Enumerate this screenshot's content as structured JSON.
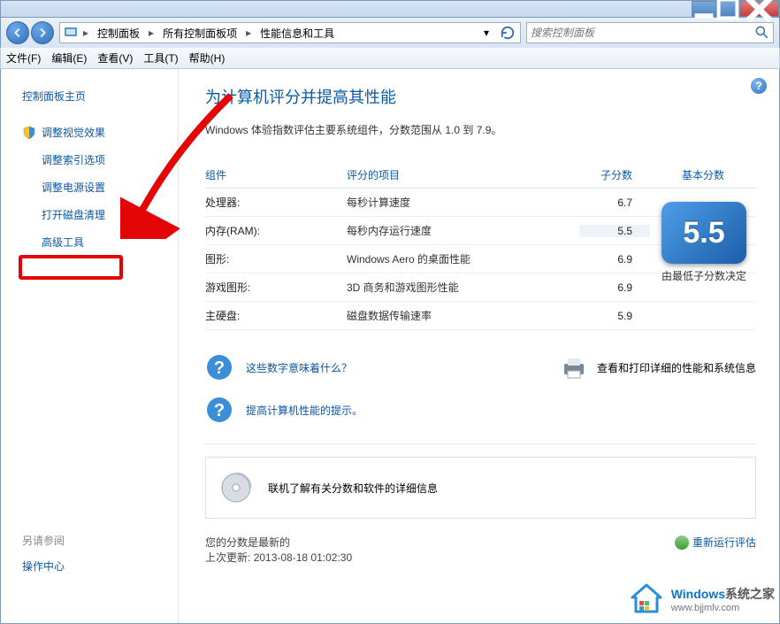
{
  "breadcrumb": {
    "p0": "控制面板",
    "p1": "所有控制面板项",
    "p2": "性能信息和工具"
  },
  "search": {
    "placeholder": "搜索控制面板"
  },
  "menu": {
    "file": "文件(F)",
    "edit": "编辑(E)",
    "view": "查看(V)",
    "tools": "工具(T)",
    "help": "帮助(H)"
  },
  "sidebar": {
    "home": "控制面板主页",
    "items": [
      "调整视觉效果",
      "调整索引选项",
      "调整电源设置",
      "打开磁盘清理",
      "高级工具"
    ],
    "see_also_label": "另请参阅",
    "see_also_link": "操作中心"
  },
  "content": {
    "title": "为计算机评分并提高其性能",
    "subtitle": "Windows 体验指数评估主要系统组件，分数范围从 1.0 到 7.9。",
    "headers": {
      "component": "组件",
      "rated": "评分的项目",
      "subscore": "子分数",
      "base": "基本分数"
    },
    "rows": [
      {
        "comp": "处理器:",
        "rated": "每秒计算速度",
        "sub": "6.7"
      },
      {
        "comp": "内存(RAM):",
        "rated": "每秒内存运行速度",
        "sub": "5.5"
      },
      {
        "comp": "图形:",
        "rated": "Windows Aero 的桌面性能",
        "sub": "6.9"
      },
      {
        "comp": "游戏图形:",
        "rated": "3D 商务和游戏图形性能",
        "sub": "6.9"
      },
      {
        "comp": "主硬盘:",
        "rated": "磁盘数据传输速率",
        "sub": "5.9"
      }
    ],
    "base_score": "5.5",
    "base_label": "由最低子分数决定",
    "links": {
      "what_numbers": "这些数字意味着什么？",
      "view_print": "查看和打印详细的性能和系统信息",
      "tips": "提高计算机性能的提示。",
      "online": "联机了解有关分数和软件的详细信息"
    },
    "footer": {
      "uptodate": "您的分数是最新的",
      "last_update_label": "上次更新:",
      "last_update_value": "2013-08-18 01:02:30",
      "rerun": "重新运行评估"
    }
  },
  "watermark": {
    "t1": "Windows",
    "t2": "系统之家",
    "url": "www.bjjmlv.com"
  }
}
